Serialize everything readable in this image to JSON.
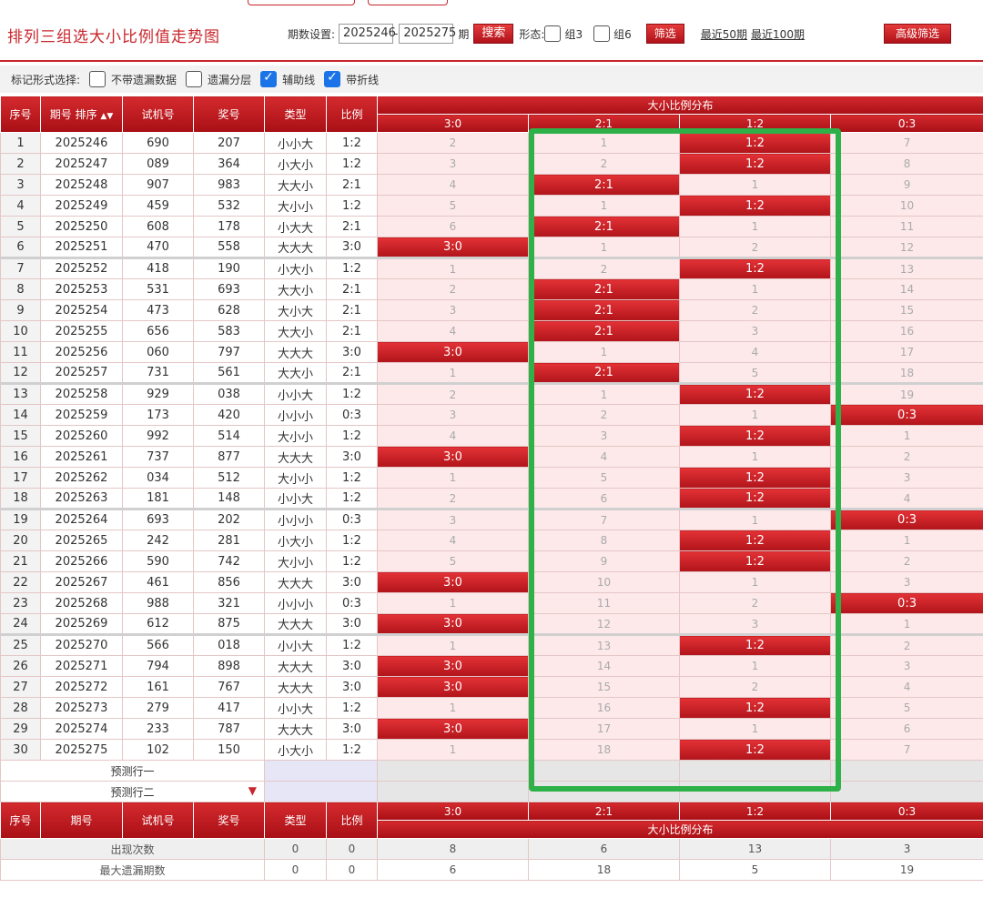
{
  "page_title": "排列三组选大小比例值走势图",
  "filter": {
    "period_label": "期数设置:",
    "period_from": "2025246",
    "period_sep": "-",
    "period_to": "2025275",
    "period_unit": "期",
    "search_label": "搜索",
    "form_label": "形态:",
    "zu3_label": "组3",
    "zu6_label": "组6",
    "screen_label": "筛选",
    "recent50": "最近50期",
    "recent100": "最近100期",
    "advanced": "高级筛选"
  },
  "marks": {
    "label": "标记形式选择:",
    "opt1": "不带遗漏数据",
    "opt2": "遗漏分层",
    "opt3": "辅助线",
    "opt4": "带折线"
  },
  "headers": {
    "idx": "序号",
    "period": "期号",
    "sort": "排序",
    "trial": "试机号",
    "prize": "奖号",
    "type": "类型",
    "ratio": "比例",
    "dist_title": "大小比例分布",
    "cols": [
      "3:0",
      "2:1",
      "1:2",
      "0:3"
    ]
  },
  "rows": [
    {
      "idx": "1",
      "period": "2025246",
      "trial": "690",
      "prize": "207",
      "type": "小小大",
      "ratio": "1:2",
      "d": [
        "2",
        "1",
        "1:2",
        "7"
      ]
    },
    {
      "idx": "2",
      "period": "2025247",
      "trial": "089",
      "prize": "364",
      "type": "小大小",
      "ratio": "1:2",
      "d": [
        "3",
        "2",
        "1:2",
        "8"
      ]
    },
    {
      "idx": "3",
      "period": "2025248",
      "trial": "907",
      "prize": "983",
      "type": "大大小",
      "ratio": "2:1",
      "d": [
        "4",
        "2:1",
        "1",
        "9"
      ]
    },
    {
      "idx": "4",
      "period": "2025249",
      "trial": "459",
      "prize": "532",
      "type": "大小小",
      "ratio": "1:2",
      "d": [
        "5",
        "1",
        "1:2",
        "10"
      ]
    },
    {
      "idx": "5",
      "period": "2025250",
      "trial": "608",
      "prize": "178",
      "type": "小大大",
      "ratio": "2:1",
      "d": [
        "6",
        "2:1",
        "1",
        "11"
      ]
    },
    {
      "idx": "6",
      "period": "2025251",
      "trial": "470",
      "prize": "558",
      "type": "大大大",
      "ratio": "3:0",
      "d": [
        "3:0",
        "1",
        "2",
        "12"
      ]
    },
    {
      "idx": "7",
      "period": "2025252",
      "trial": "418",
      "prize": "190",
      "type": "小大小",
      "ratio": "1:2",
      "d": [
        "1",
        "2",
        "1:2",
        "13"
      ]
    },
    {
      "idx": "8",
      "period": "2025253",
      "trial": "531",
      "prize": "693",
      "type": "大大小",
      "ratio": "2:1",
      "d": [
        "2",
        "2:1",
        "1",
        "14"
      ]
    },
    {
      "idx": "9",
      "period": "2025254",
      "trial": "473",
      "prize": "628",
      "type": "大小大",
      "ratio": "2:1",
      "d": [
        "3",
        "2:1",
        "2",
        "15"
      ]
    },
    {
      "idx": "10",
      "period": "2025255",
      "trial": "656",
      "prize": "583",
      "type": "大大小",
      "ratio": "2:1",
      "d": [
        "4",
        "2:1",
        "3",
        "16"
      ]
    },
    {
      "idx": "11",
      "period": "2025256",
      "trial": "060",
      "prize": "797",
      "type": "大大大",
      "ratio": "3:0",
      "d": [
        "3:0",
        "1",
        "4",
        "17"
      ]
    },
    {
      "idx": "12",
      "period": "2025257",
      "trial": "731",
      "prize": "561",
      "type": "大大小",
      "ratio": "2:1",
      "d": [
        "1",
        "2:1",
        "5",
        "18"
      ]
    },
    {
      "idx": "13",
      "period": "2025258",
      "trial": "929",
      "prize": "038",
      "type": "小小大",
      "ratio": "1:2",
      "d": [
        "2",
        "1",
        "1:2",
        "19"
      ]
    },
    {
      "idx": "14",
      "period": "2025259",
      "trial": "173",
      "prize": "420",
      "type": "小小小",
      "ratio": "0:3",
      "d": [
        "3",
        "2",
        "1",
        "0:3"
      ]
    },
    {
      "idx": "15",
      "period": "2025260",
      "trial": "992",
      "prize": "514",
      "type": "大小小",
      "ratio": "1:2",
      "d": [
        "4",
        "3",
        "1:2",
        "1"
      ]
    },
    {
      "idx": "16",
      "period": "2025261",
      "trial": "737",
      "prize": "877",
      "type": "大大大",
      "ratio": "3:0",
      "d": [
        "3:0",
        "4",
        "1",
        "2"
      ]
    },
    {
      "idx": "17",
      "period": "2025262",
      "trial": "034",
      "prize": "512",
      "type": "大小小",
      "ratio": "1:2",
      "d": [
        "1",
        "5",
        "1:2",
        "3"
      ]
    },
    {
      "idx": "18",
      "period": "2025263",
      "trial": "181",
      "prize": "148",
      "type": "小小大",
      "ratio": "1:2",
      "d": [
        "2",
        "6",
        "1:2",
        "4"
      ]
    },
    {
      "idx": "19",
      "period": "2025264",
      "trial": "693",
      "prize": "202",
      "type": "小小小",
      "ratio": "0:3",
      "d": [
        "3",
        "7",
        "1",
        "0:3"
      ]
    },
    {
      "idx": "20",
      "period": "2025265",
      "trial": "242",
      "prize": "281",
      "type": "小大小",
      "ratio": "1:2",
      "d": [
        "4",
        "8",
        "1:2",
        "1"
      ]
    },
    {
      "idx": "21",
      "period": "2025266",
      "trial": "590",
      "prize": "742",
      "type": "大小小",
      "ratio": "1:2",
      "d": [
        "5",
        "9",
        "1:2",
        "2"
      ]
    },
    {
      "idx": "22",
      "period": "2025267",
      "trial": "461",
      "prize": "856",
      "type": "大大大",
      "ratio": "3:0",
      "d": [
        "3:0",
        "10",
        "1",
        "3"
      ]
    },
    {
      "idx": "23",
      "period": "2025268",
      "trial": "988",
      "prize": "321",
      "type": "小小小",
      "ratio": "0:3",
      "d": [
        "1",
        "11",
        "2",
        "0:3"
      ]
    },
    {
      "idx": "24",
      "period": "2025269",
      "trial": "612",
      "prize": "875",
      "type": "大大大",
      "ratio": "3:0",
      "d": [
        "3:0",
        "12",
        "3",
        "1"
      ]
    },
    {
      "idx": "25",
      "period": "2025270",
      "trial": "566",
      "prize": "018",
      "type": "小小大",
      "ratio": "1:2",
      "d": [
        "1",
        "13",
        "1:2",
        "2"
      ]
    },
    {
      "idx": "26",
      "period": "2025271",
      "trial": "794",
      "prize": "898",
      "type": "大大大",
      "ratio": "3:0",
      "d": [
        "3:0",
        "14",
        "1",
        "3"
      ]
    },
    {
      "idx": "27",
      "period": "2025272",
      "trial": "161",
      "prize": "767",
      "type": "大大大",
      "ratio": "3:0",
      "d": [
        "3:0",
        "15",
        "2",
        "4"
      ]
    },
    {
      "idx": "28",
      "period": "2025273",
      "trial": "279",
      "prize": "417",
      "type": "小小大",
      "ratio": "1:2",
      "d": [
        "1",
        "16",
        "1:2",
        "5"
      ]
    },
    {
      "idx": "29",
      "period": "2025274",
      "trial": "233",
      "prize": "787",
      "type": "大大大",
      "ratio": "3:0",
      "d": [
        "3:0",
        "17",
        "1",
        "6"
      ]
    },
    {
      "idx": "30",
      "period": "2025275",
      "trial": "102",
      "prize": "150",
      "type": "小大小",
      "ratio": "1:2",
      "d": [
        "1",
        "18",
        "1:2",
        "7"
      ]
    }
  ],
  "predict": [
    "预测行一",
    "预测行二"
  ],
  "stats": [
    {
      "label": "出现次数",
      "type": "0",
      "ratio": "0",
      "d": [
        "8",
        "6",
        "13",
        "3"
      ]
    },
    {
      "label": "最大遗漏期数",
      "type": "0",
      "ratio": "0",
      "d": [
        "6",
        "18",
        "5",
        "19"
      ]
    }
  ]
}
